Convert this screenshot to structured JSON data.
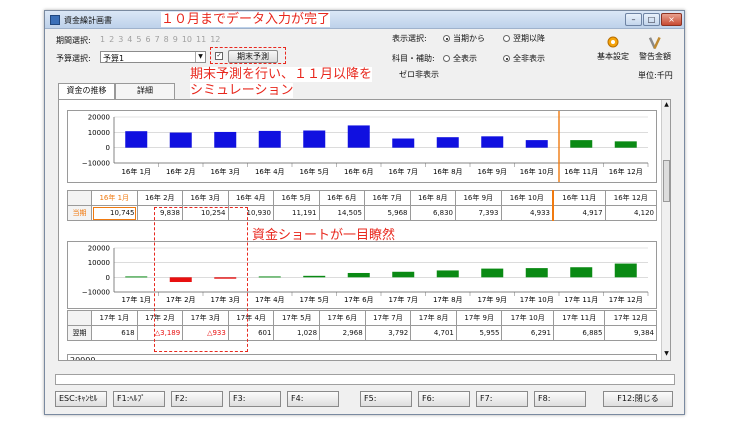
{
  "window": {
    "title": "資金繰計画書",
    "minimize": "–",
    "maximize": "□",
    "close": "×"
  },
  "annotations": {
    "top": "１０月までデータ入力が完了",
    "middle_line1": "期末予測を行い、１１月以降を",
    "middle_line2": "シミュレーション",
    "shortage": "資金ショートが一目瞭然"
  },
  "header": {
    "period_label": "期間選択:",
    "months": [
      "1",
      "2",
      "3",
      "4",
      "5",
      "6",
      "7",
      "8",
      "9",
      "10",
      "11",
      "12"
    ],
    "budget_label": "予算選択:",
    "budget_value": "予算1",
    "forecast_check": "✓",
    "forecast_button": "期末予測",
    "display_label": "表示選択:",
    "display_opt1": "当期から",
    "display_opt2": "翌期以降",
    "subject_label": "科目・補助:",
    "subject_opt1": "全表示",
    "subject_opt2": "全非表示",
    "zero_hidden": "ゼロ非表示",
    "settings_label": "基本設定",
    "alert_label": "警告金額",
    "unit": "単位:千円"
  },
  "tabs": [
    {
      "label": "資金の推移"
    },
    {
      "label": "詳細"
    }
  ],
  "charts": {
    "yticks": [
      "20000",
      "10000",
      "0",
      "−10000"
    ],
    "third_ytick": "20000"
  },
  "chart_data": [
    {
      "type": "bar",
      "categories": [
        "16年 1月",
        "16年 2月",
        "16年 3月",
        "16年 4月",
        "16年 5月",
        "16年 6月",
        "16年 7月",
        "16年 8月",
        "16年 9月",
        "16年 10月",
        "16年 11月",
        "16年 12月"
      ],
      "values": [
        10745,
        9838,
        10254,
        10930,
        11191,
        14505,
        5968,
        6830,
        7393,
        4933,
        4917,
        4120
      ],
      "ylim": [
        -10000,
        20000
      ],
      "colors": [
        "#1010e0",
        "#1010e0",
        "#1010e0",
        "#1010e0",
        "#1010e0",
        "#1010e0",
        "#1010e0",
        "#1010e0",
        "#1010e0",
        "#1010e0",
        "#0a8a14",
        "#0a8a14"
      ],
      "row_label": "当期",
      "value_labels": [
        "10,745",
        "9,838",
        "10,254",
        "10,930",
        "11,191",
        "14,505",
        "5,968",
        "6,830",
        "7,393",
        "4,933",
        "4,917",
        "4,120"
      ]
    },
    {
      "type": "bar",
      "categories": [
        "17年 1月",
        "17年 2月",
        "17年 3月",
        "17年 4月",
        "17年 5月",
        "17年 6月",
        "17年 7月",
        "17年 8月",
        "17年 9月",
        "17年 10月",
        "17年 11月",
        "17年 12月"
      ],
      "values": [
        618,
        -3189,
        -933,
        601,
        1028,
        2968,
        3792,
        4701,
        5955,
        6291,
        6885,
        9384
      ],
      "ylim": [
        -10000,
        20000
      ],
      "colors": [
        "#0a8a14",
        "#e81010",
        "#e81010",
        "#0a8a14",
        "#0a8a14",
        "#0a8a14",
        "#0a8a14",
        "#0a8a14",
        "#0a8a14",
        "#0a8a14",
        "#0a8a14",
        "#0a8a14"
      ],
      "row_label": "翌期",
      "value_labels": [
        "618",
        "△3,189",
        "△933",
        "601",
        "1,028",
        "2,968",
        "3,792",
        "4,701",
        "5,955",
        "6,291",
        "6,885",
        "9,384"
      ]
    }
  ],
  "fkeys": [
    "ESC:ｷｬﾝｾﾙ",
    "F1:ﾍﾙﾌﾟ",
    "F2:",
    "F3:",
    "F4:",
    "F5:",
    "F6:",
    "F7:",
    "F8:",
    "F12:閉じる"
  ]
}
